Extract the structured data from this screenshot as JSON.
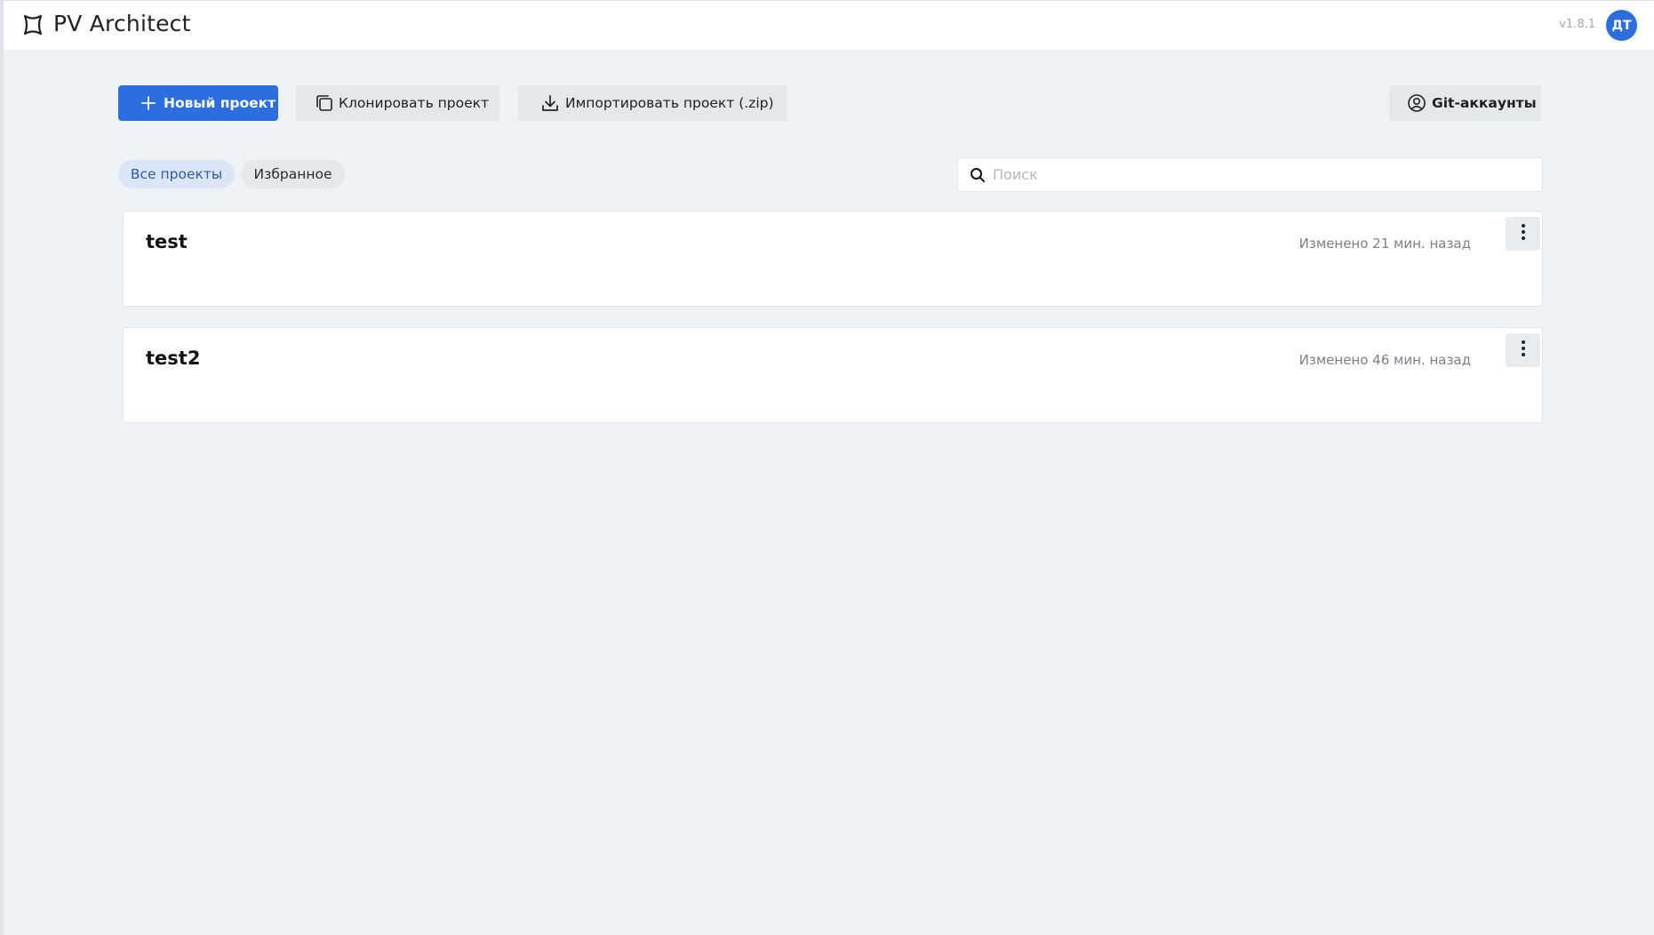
{
  "header": {
    "title": "PV Architect",
    "logo_icon": "app-logo-icon",
    "version": "v1.8.1",
    "avatar_initials": "ДТ",
    "avatar_color": "#2c6de0"
  },
  "toolbar": {
    "new_project_label": "Новый проект",
    "new_project_icon": "plus-icon",
    "clone_project_label": "Клонировать проект",
    "clone_project_icon": "copy-icon",
    "import_project_label": "Импортировать проект (.zip)",
    "import_project_icon": "download-icon",
    "git_accounts_label": "Git-аккаунты",
    "git_accounts_icon": "user-circle-icon",
    "primary_color": "#2c6de0"
  },
  "filters": {
    "all_label": "Все проекты",
    "favorites_label": "Избранное",
    "active": "Все проекты"
  },
  "search": {
    "placeholder": "Поиск",
    "value": "",
    "icon": "search-icon"
  },
  "projects": [
    {
      "name": "test",
      "modified": "Изменено 21 мин. назад",
      "menu_icon": "more-vertical-icon"
    },
    {
      "name": "test2",
      "modified": "Изменено 46 мин. назад",
      "menu_icon": "more-vertical-icon"
    }
  ]
}
